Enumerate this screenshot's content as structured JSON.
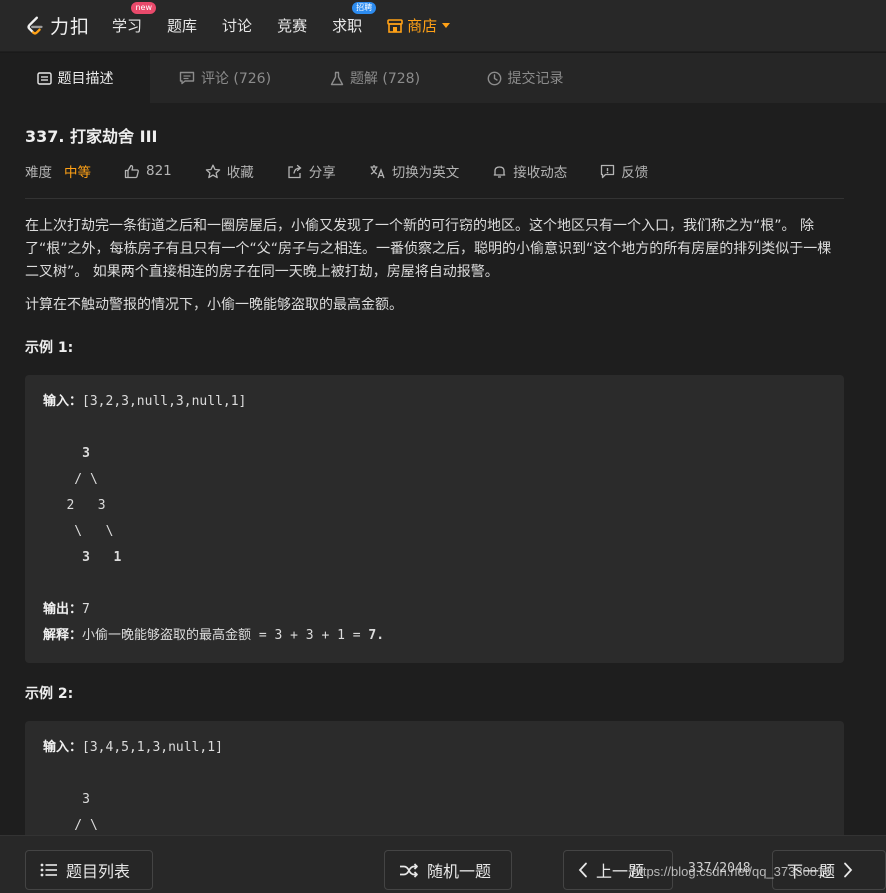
{
  "nav": {
    "logo_text": "力扣",
    "items": [
      {
        "label": "学习",
        "badge": "new"
      },
      {
        "label": "题库"
      },
      {
        "label": "讨论"
      },
      {
        "label": "竞赛"
      },
      {
        "label": "求职",
        "badge": "招聘"
      }
    ],
    "shop_label": "商店"
  },
  "tabs": [
    {
      "label": "题目描述",
      "icon": "document-icon",
      "active": true
    },
    {
      "label": "评论 (726)",
      "icon": "comment-icon"
    },
    {
      "label": "题解 (728)",
      "icon": "flask-icon"
    },
    {
      "label": "提交记录",
      "icon": "clock-icon"
    }
  ],
  "problem": {
    "title": "337. 打家劫舍 III",
    "difficulty_label": "难度",
    "difficulty": "中等",
    "likes": "821",
    "favorite": "收藏",
    "share": "分享",
    "switch_lang": "切换为英文",
    "subscribe": "接收动态",
    "feedback": "反馈",
    "desc1": "在上次打劫完一条街道之后和一圈房屋后，小偷又发现了一个新的可行窃的地区。这个地区只有一个入口，我们称之为“根”。 除了“根”之外，每栋房子有且只有一个“父“房子与之相连。一番侦察之后，聪明的小偷意识到“这个地方的所有房屋的排列类似于一棵二叉树”。 如果两个直接相连的房子在同一天晚上被打劫，房屋将自动报警。",
    "desc2": "计算在不触动警报的情况下，小偷一晚能够盗取的最高金额。"
  },
  "example1": {
    "title": "示例 1:",
    "input_label": "输入：",
    "input": "[3,2,3,null,3,null,1]",
    "tree": [
      "     3",
      "    / \\",
      "   2   3",
      "    \\   \\",
      "     3   1"
    ],
    "output_label": "输出：",
    "output": "7",
    "explain_label": "解释：",
    "explain": "小偷一晚能够盗取的最高金额 = 3 + 3 + 1 = ",
    "explain_result": "7."
  },
  "example2": {
    "title": "示例 2:",
    "input_label": "输入：",
    "input": "[3,4,5,1,3,null,1]",
    "tree": [
      "     3",
      "    / \\"
    ]
  },
  "bottom": {
    "list_label": "题目列表",
    "random_label": "随机一题",
    "prev_label": "上一题",
    "pager": "337/2048",
    "next_label": "下一题"
  },
  "watermark": "https://blog.csdn.net/qq_37330816",
  "colors": {
    "accent": "#ffa116",
    "new_badge": "#e94a6b",
    "hire_badge": "#2d8cf0"
  }
}
